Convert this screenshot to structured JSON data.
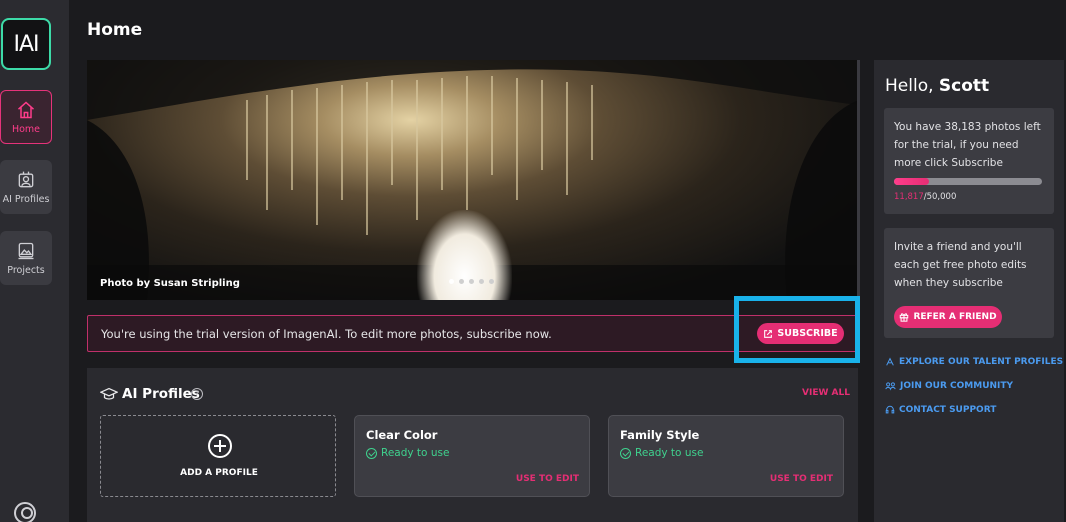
{
  "sidebar": {
    "logo": "IAI",
    "items": [
      {
        "label": "Home",
        "icon": "home-icon",
        "active": true
      },
      {
        "label": "AI Profiles",
        "icon": "ai-profiles-icon",
        "active": false
      },
      {
        "label": "Projects",
        "icon": "projects-icon",
        "active": false
      }
    ],
    "bottom_icon": "user-account-icon"
  },
  "header": {
    "title": "Home"
  },
  "hero": {
    "credit": "Photo by Susan Stripling",
    "slides": 5,
    "active_slide": 1
  },
  "trial_banner": {
    "text": "You're using the trial version of ImagenAI. To edit more photos, subscribe now.",
    "button_label": "SUBSCRIBE",
    "button_icon": "external-link-icon"
  },
  "profiles": {
    "title": "AI Profiles",
    "help_icon": "help-circle-icon",
    "view_all": "VIEW ALL",
    "add_label": "ADD A PROFILE",
    "cards": [
      {
        "title": "Clear Color",
        "status": "Ready to use",
        "action": "USE TO EDIT"
      },
      {
        "title": "Family Style",
        "status": "Ready to use",
        "action": "USE TO EDIT"
      }
    ]
  },
  "right_panel": {
    "greeting": "Hello,",
    "name": "Scott",
    "trial_info": "You have 38,183 photos left for the trial, if you need more click Subscribe",
    "used": "11,817",
    "total": "/50,000",
    "progress_fraction": 0.236,
    "invite_text": "Invite a friend and you'll each get free photo edits when they subscribe",
    "refer_label": "REFER A FRIEND",
    "links": [
      {
        "label": "EXPLORE OUR TALENT PROFILES",
        "icon": "talent-icon"
      },
      {
        "label": "JOIN OUR COMMUNITY",
        "icon": "community-icon"
      },
      {
        "label": "CONTACT SUPPORT",
        "icon": "support-icon"
      }
    ]
  },
  "colors": {
    "accent": "#e52e74",
    "link": "#4b9bf0",
    "success": "#3fd28e",
    "highlight": "#19b2ea"
  }
}
